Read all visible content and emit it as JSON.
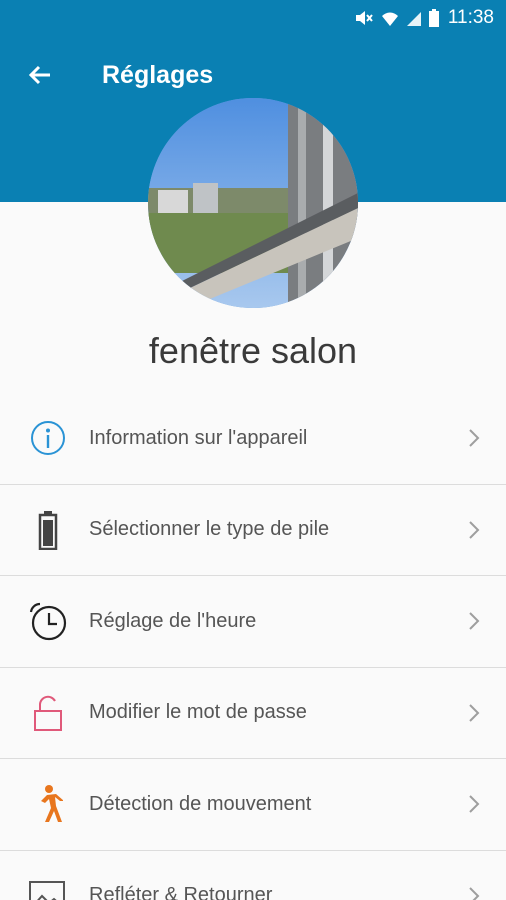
{
  "status_bar": {
    "time": "11:38"
  },
  "toolbar": {
    "title": "Réglages"
  },
  "device": {
    "name": "fenêtre salon"
  },
  "menu": [
    {
      "label": "Information sur l'appareil",
      "icon": "info-icon"
    },
    {
      "label": "Sélectionner le type de pile",
      "icon": "battery-icon"
    },
    {
      "label": "Réglage de l'heure",
      "icon": "alarm-clock-icon"
    },
    {
      "label": "Modifier le mot de passe",
      "icon": "unlock-icon"
    },
    {
      "label": "Détection de mouvement",
      "icon": "walking-person-icon"
    },
    {
      "label": "Refléter & Retourner",
      "icon": "image-icon"
    }
  ],
  "colors": {
    "header": "#0a80b3",
    "info_icon": "#2a93d5",
    "lock_icon": "#e0597a",
    "motion_icon": "#e8761e"
  }
}
